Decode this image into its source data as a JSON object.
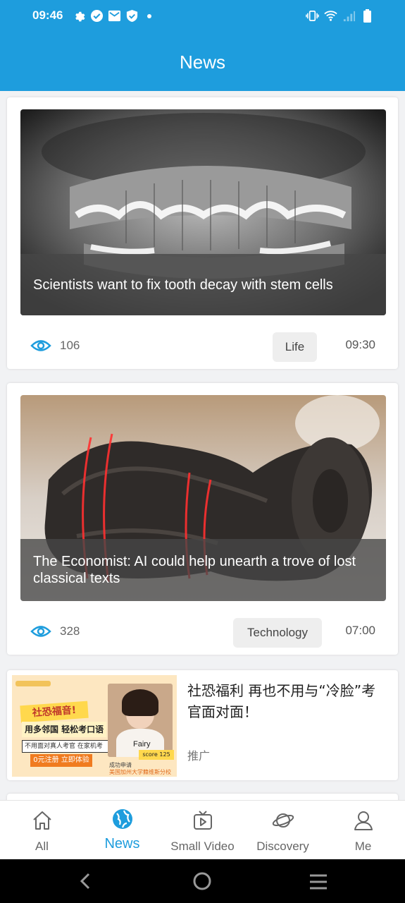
{
  "status_bar": {
    "time": "09:46",
    "left_icons": [
      "settings-icon",
      "check-circle-icon",
      "mail-icon",
      "shield-check-icon",
      "notification-dot-icon"
    ],
    "right_icons": [
      "vibrate-icon",
      "wifi-icon",
      "signal-icon",
      "battery-icon"
    ]
  },
  "header": {
    "title": "News"
  },
  "colors": {
    "primary": "#1e9ddd",
    "tab_active": "#1e9ddd",
    "tab_inactive": "#666666"
  },
  "news": [
    {
      "caption": "Scientists want to fix tooth decay with stem cells",
      "views": "106",
      "tag": "Life",
      "time": "09:30"
    },
    {
      "caption": "The Economist: AI could help unearth a trove of lost classical texts",
      "views": "328",
      "tag": "Technology",
      "time": "07:00"
    }
  ],
  "ad": {
    "title": "社恐福利 再也不用与“冷脸”考官面对面！",
    "sponsor_label": "推广",
    "banner": {
      "headline_1": "社恐福音!",
      "headline_2": "用多邻国 轻松考口语",
      "line_3": "不用面对真人考官 在家机考",
      "cta": "0元注册 立即体验",
      "person_name": "Fairy",
      "score": "score 125",
      "footer_1": "成功申请",
      "footer_2": "美国加州大学籍维斯分校"
    }
  },
  "tabs": [
    {
      "label": "All",
      "icon": "home-icon",
      "active": false
    },
    {
      "label": "News",
      "icon": "globe-icon",
      "active": true
    },
    {
      "label": "Small Video",
      "icon": "tv-play-icon",
      "active": false
    },
    {
      "label": "Discovery",
      "icon": "planet-icon",
      "active": false
    },
    {
      "label": "Me",
      "icon": "person-icon",
      "active": false
    }
  ],
  "nav_buttons": [
    "back-icon",
    "home-circle-icon",
    "menu-icon"
  ]
}
